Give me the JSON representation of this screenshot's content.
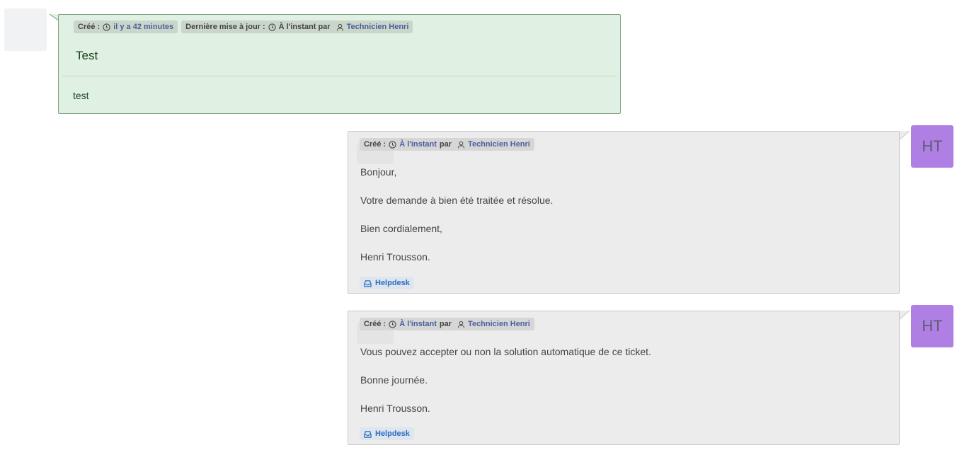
{
  "followup": {
    "created_label": "Créé :",
    "created_value": "il y a 42 minutes",
    "updated_label": "Dernière mise à jour :",
    "updated_value": "À l'instant par",
    "updated_user": "Technicien Henri",
    "title": "Test",
    "content": "test"
  },
  "solutions": [
    {
      "created_label": "Créé :",
      "created_value": "À l'instant",
      "by_label": "par",
      "user": "Technicien Henri",
      "avatar_initials": "HT",
      "paragraphs": [
        "Bonjour,",
        "Votre demande à bien été traitée et résolue.",
        "Bien cordialement,",
        "Henri Trousson."
      ],
      "source": "Helpdesk"
    },
    {
      "created_label": "Créé :",
      "created_value": "À l'instant",
      "by_label": "par",
      "user": "Technicien Henri",
      "avatar_initials": "HT",
      "paragraphs": [
        "Vous pouvez accepter ou non la solution automatique de ce ticket.",
        "Bonne journée.",
        "Henri Trousson."
      ],
      "source": "Helpdesk"
    }
  ],
  "icons": {
    "clock": "clock-icon",
    "user": "user-icon",
    "inbox": "inbox-icon"
  },
  "colors": {
    "followup_bg": "#e0f0e2",
    "solution_bg": "#ececec",
    "avatar_bg": "#b07fe3",
    "link": "#4a5fa0",
    "source_text": "#2c6cc0"
  }
}
